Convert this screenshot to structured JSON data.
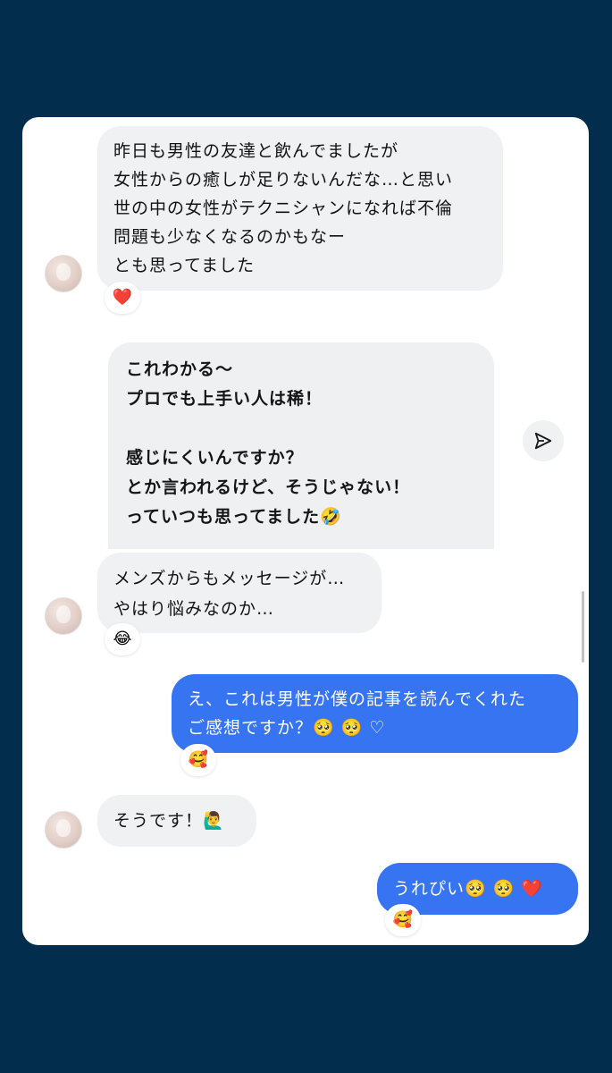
{
  "messages": [
    {
      "text": "昨日も男性の友達と飲んでましたが\n女性からの癒しが足りないんだな…と思い\n世の中の女性がテクニシャンになれば不倫\n問題も少なくなるのかもなー\nとも思ってました",
      "reaction": "❤️"
    },
    {
      "quoted": "これわかる〜\nプロでも上手い人は稀！\n\n感じにくいんですか？\nとか言われるけど、そうじゃない！\nっていつも思ってました🤣"
    },
    {
      "text": "メンズからもメッセージが…\nやはり悩みなのか…",
      "reaction": "😂"
    },
    {
      "text": "え、これは男性が僕の記事を読んでくれた\nご感想ですか？🥺 🥺 ♡",
      "reaction": "🥰"
    },
    {
      "text": "そうです！🙋‍♂️"
    },
    {
      "text": "うれぴい🥺 🥺 ❤️",
      "reaction": "🥰"
    }
  ],
  "colors": {
    "background": "#032d4d",
    "incoming_bubble": "#f0f1f3",
    "outgoing_bubble": "#3674f2"
  },
  "icons": {
    "share": "paper-plane-icon",
    "avatar": "user-avatar"
  }
}
